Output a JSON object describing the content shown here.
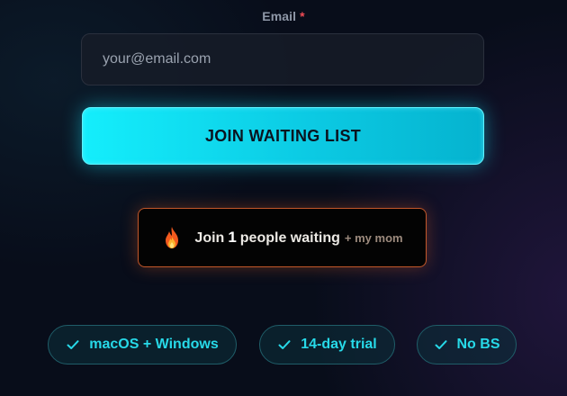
{
  "form": {
    "email_label": "Email",
    "required_marker": "*",
    "email_value": "",
    "email_placeholder": "your@email.com",
    "submit_label": "JOIN WAITING LIST"
  },
  "waitlist": {
    "icon": "flame-icon",
    "prefix": "Join",
    "count": "1",
    "suffix": "people waiting",
    "aside": "+ my mom"
  },
  "features": [
    {
      "icon": "check-icon",
      "label": "macOS + Windows"
    },
    {
      "icon": "check-icon",
      "label": "14-day trial"
    },
    {
      "icon": "check-icon",
      "label": "No BS"
    }
  ],
  "colors": {
    "background": "#080d1a",
    "accent_cyan": "#14eefc",
    "badge_glow_orange": "#c2572a",
    "pill_text": "#27d9e8",
    "required_red": "#ef4b55"
  }
}
